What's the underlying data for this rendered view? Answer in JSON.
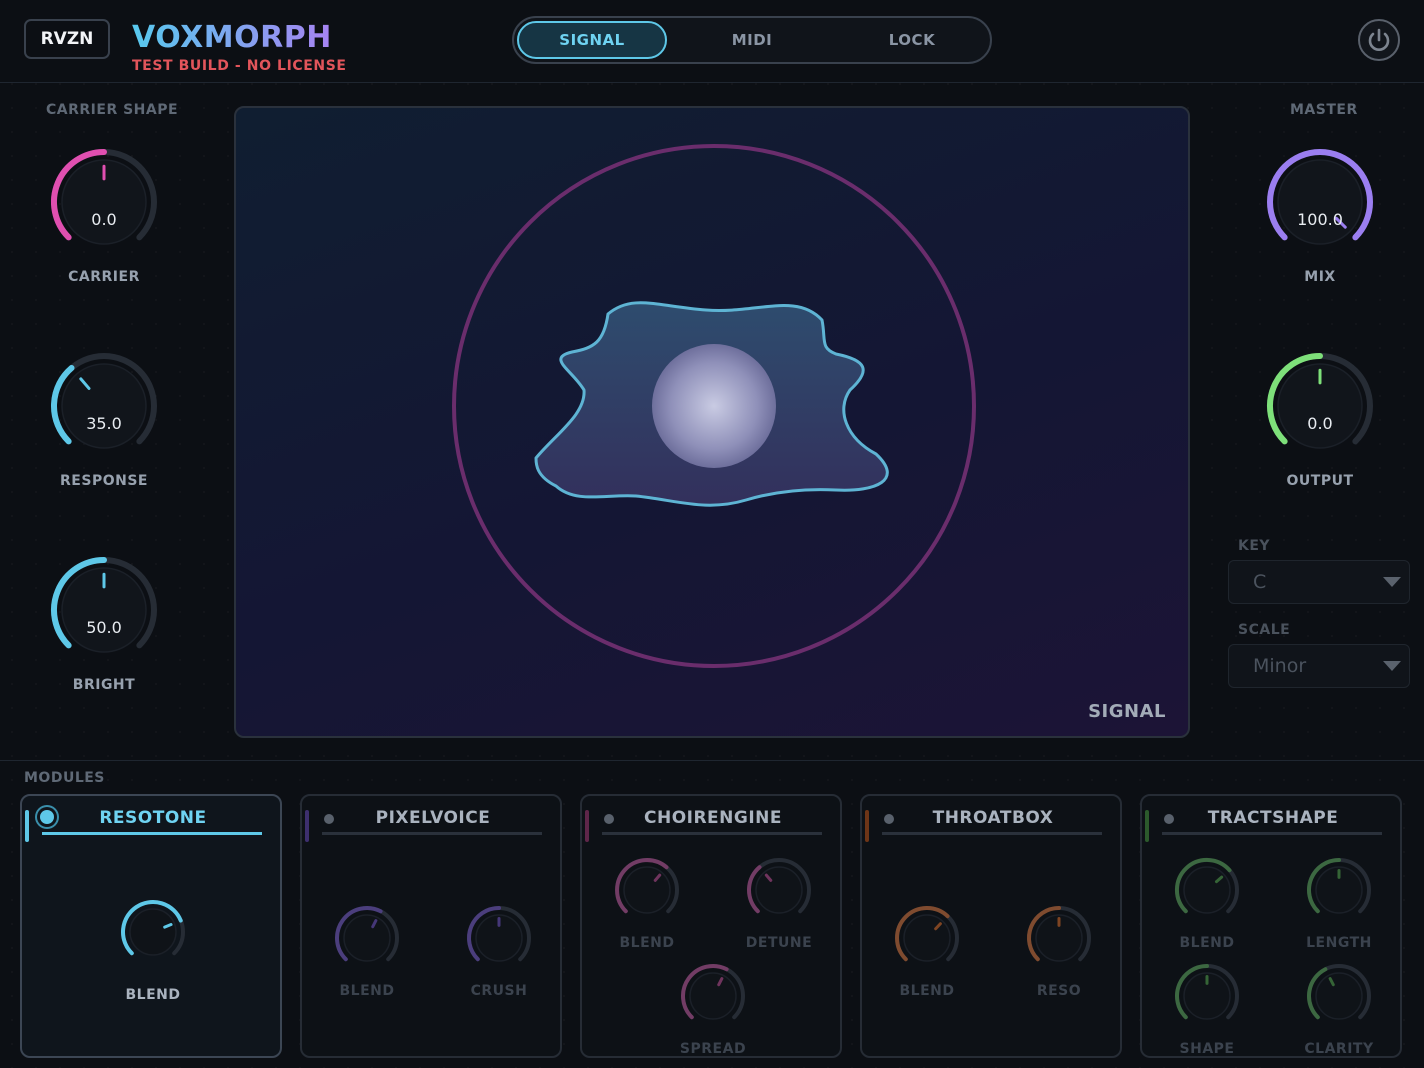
{
  "header": {
    "brand": "RVZN",
    "title": "VOXMORPH",
    "license": "TEST BUILD - NO LICENSE",
    "tabs": [
      "SIGNAL",
      "MIDI",
      "LOCK"
    ],
    "active_tab": "SIGNAL"
  },
  "left": {
    "section": "CARRIER SHAPE",
    "knobs": [
      {
        "label": "CARRIER",
        "value": "0.0",
        "level": 0.5,
        "color": "#e04fb0"
      },
      {
        "label": "RESPONSE",
        "value": "35.0",
        "level": 0.35,
        "color": "#5ec8e8"
      },
      {
        "label": "BRIGHT",
        "value": "50.0",
        "level": 0.5,
        "color": "#5ec8e8"
      }
    ]
  },
  "right": {
    "section": "MASTER",
    "knobs": [
      {
        "label": "MIX",
        "value": "100.0",
        "level": 1.0,
        "color": "#9b7ef0"
      },
      {
        "label": "OUTPUT",
        "value": "0.0",
        "level": 0.5,
        "color": "#7ee07a"
      }
    ],
    "key_label": "KEY",
    "key_value": "C",
    "scale_label": "SCALE",
    "scale_value": "Minor"
  },
  "viz": {
    "label": "SIGNAL"
  },
  "modules": {
    "section": "MODULES",
    "items": [
      {
        "title": "RESOTONE",
        "color": "#5ec8e8",
        "active": true,
        "knobs": [
          {
            "label": "BLEND",
            "level": 0.75
          }
        ]
      },
      {
        "title": "PIXELVOICE",
        "color": "#6a4fb8",
        "active": false,
        "knobs": [
          {
            "label": "BLEND",
            "level": 0.6
          },
          {
            "label": "CRUSH",
            "level": 0.5
          }
        ]
      },
      {
        "title": "CHOIRENGINE",
        "color": "#b04a8c",
        "active": false,
        "knobs": [
          {
            "label": "BLEND",
            "level": 0.65
          },
          {
            "label": "DETUNE",
            "level": 0.35
          },
          {
            "label": "SPREAD",
            "level": 0.6
          }
        ]
      },
      {
        "title": "THROATBOX",
        "color": "#c8662a",
        "active": false,
        "knobs": [
          {
            "label": "BLEND",
            "level": 0.66
          },
          {
            "label": "RESO",
            "level": 0.5
          }
        ]
      },
      {
        "title": "TRACTSHAPE",
        "color": "#4f9a4a",
        "active": false,
        "knobs": [
          {
            "label": "BLEND",
            "level": 0.68
          },
          {
            "label": "LENGTH",
            "level": 0.5
          },
          {
            "label": "SHAPE",
            "level": 0.5
          },
          {
            "label": "CLARITY",
            "level": 0.4
          }
        ]
      }
    ]
  }
}
